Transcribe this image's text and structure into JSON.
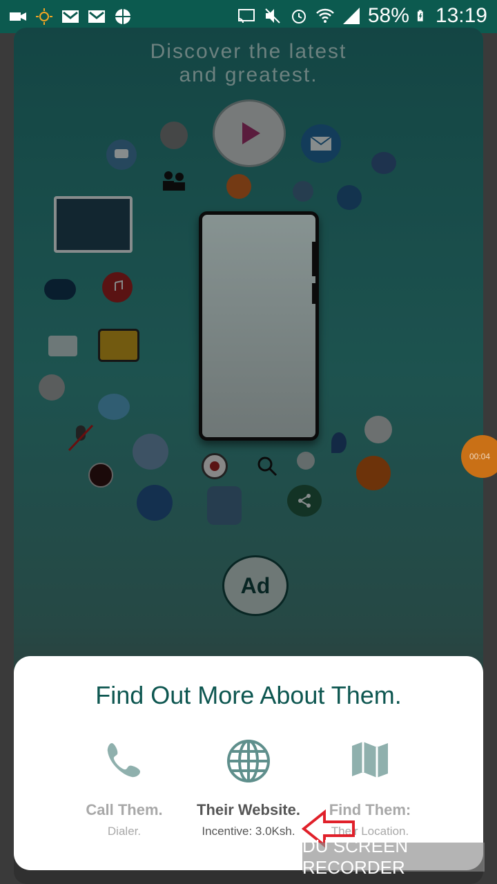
{
  "status_bar": {
    "battery_percent": "58%",
    "time": "13:19",
    "left_icons": [
      "video-camera-icon",
      "brightness-icon",
      "gmail-icon",
      "gmail-icon",
      "basketball-icon"
    ],
    "right_icons": [
      "cast-icon",
      "mute-icon",
      "alarm-icon",
      "wifi-icon",
      "signal-icon",
      "battery-charging-icon"
    ]
  },
  "ad": {
    "headline_line1": "Discover the latest",
    "headline_line2": "and greatest.",
    "badge": "Ad"
  },
  "recorder_bubble": {
    "timer": "00:04"
  },
  "sheet": {
    "title": "Find Out More About Them.",
    "options": [
      {
        "label": "Call Them.",
        "sub": "Dialer.",
        "icon": "phone-icon",
        "state": "inactive"
      },
      {
        "label": "Their Website.",
        "sub": "Incentive: 3.0Ksh.",
        "icon": "globe-icon",
        "state": "active"
      },
      {
        "label": "Find Them:",
        "sub": "Their Location.",
        "icon": "map-icon",
        "state": "inactive"
      }
    ]
  },
  "watermark": "DU SCREEN RECORDER",
  "colors": {
    "status_bar": "#0c5a4f",
    "title": "#0d5650",
    "icon_teal": "#5f8f8c",
    "recorder": "#c97016",
    "arrow": "#e0202a"
  }
}
